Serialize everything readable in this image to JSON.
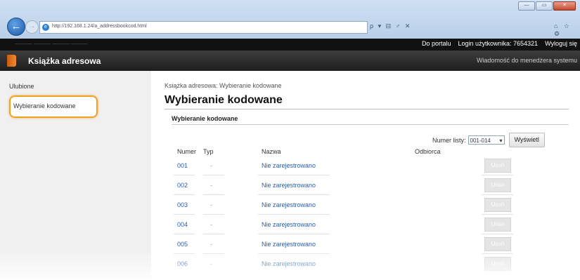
{
  "window": {
    "minimize": "—",
    "maximize": "▭",
    "close": "✕"
  },
  "browser": {
    "back": "←",
    "forward": "→",
    "url": "http://192.168.1.24/a_addressbookcod.html",
    "nav_tools": "ρ ▾ ⊟ ♂ ✕",
    "tab_icons": "⌂ ☆ ⚙"
  },
  "top_bar": {
    "device_name": "——— ——— ———  ———",
    "portal_link": "Do portalu",
    "login_label": "Login użytkownika: 7654321",
    "logout_link": "Wyloguj się"
  },
  "header": {
    "title": "Książka adresowa",
    "message_link": "Wiadomość do menedżera systemu"
  },
  "sidebar": {
    "items": [
      {
        "label": "Ulubione"
      },
      {
        "label": "Wybieranie kodowane"
      }
    ]
  },
  "main": {
    "breadcrumb": "Książka adresowa: Wybieranie kodowane",
    "heading": "Wybieranie kodowane",
    "section_heading": "Wybieranie kodowane",
    "list_label": "Numer listy:",
    "list_value": "001-014",
    "show_button": "Wyświetl",
    "columns": [
      "Numer",
      "Typ",
      "Nazwa",
      "Odbiorca"
    ],
    "rows": [
      {
        "number": "001",
        "type": "-",
        "name": "Nie zarejestrowano",
        "delete": "Usuń"
      },
      {
        "number": "002",
        "type": "-",
        "name": "Nie zarejestrowano",
        "delete": "Usuń"
      },
      {
        "number": "003",
        "type": "-",
        "name": "Nie zarejestrowano",
        "delete": "Usuń"
      },
      {
        "number": "004",
        "type": "-",
        "name": "Nie zarejestrowano",
        "delete": "Usuń"
      },
      {
        "number": "005",
        "type": "-",
        "name": "Nie zarejestrowano",
        "delete": "Usuń"
      },
      {
        "number": "006",
        "type": "-",
        "name": "Nie zarejestrowano",
        "delete": "Usuń"
      }
    ]
  },
  "colors": {
    "highlight": "#f4a020",
    "link": "#2a5db0",
    "header_bg": "#111111"
  }
}
